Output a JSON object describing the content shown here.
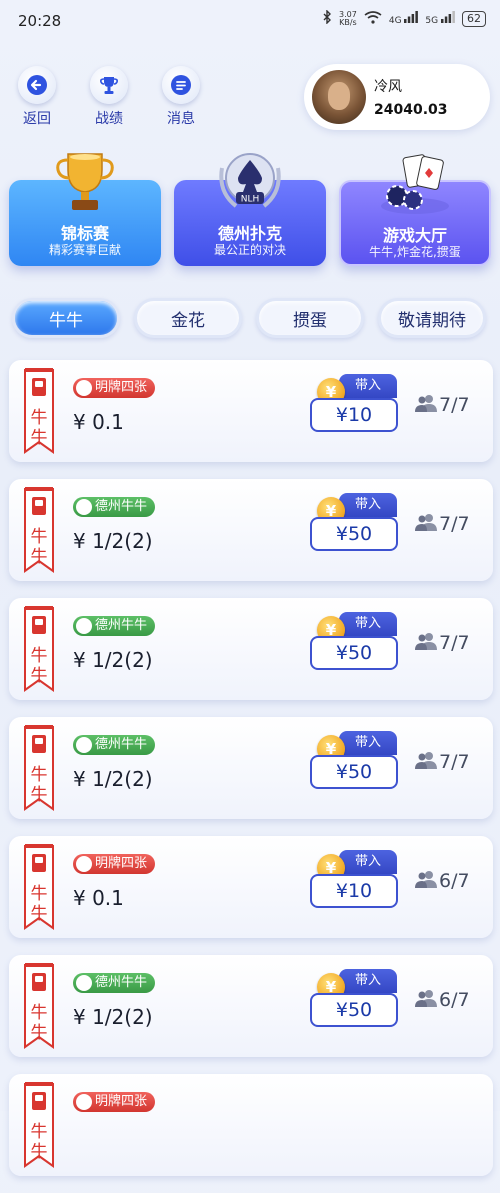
{
  "status_bar": {
    "time": "20:28",
    "net_speed": "3.07",
    "net_unit": "KB/s",
    "signal1": "4G",
    "signal2": "5G",
    "battery": "62"
  },
  "nav": {
    "back": "返回",
    "record": "战绩",
    "messages": "消息"
  },
  "user": {
    "name": "冷风",
    "balance": "24040.03"
  },
  "features": [
    {
      "title": "锦标赛",
      "subtitle": "精彩赛事巨献"
    },
    {
      "title": "德州扑克",
      "subtitle": "最公正的对决",
      "logo_text": "NLH"
    },
    {
      "title": "游戏大厅",
      "subtitle": "牛牛,炸金花,掼蛋"
    }
  ],
  "tabs": [
    "牛牛",
    "金花",
    "掼蛋",
    "敬请期待"
  ],
  "active_tab": 0,
  "rooms": [
    {
      "banner": [
        "牛",
        "牛"
      ],
      "badge": "明牌四张",
      "badge_color": "red",
      "stake": "¥ 0.1",
      "buyin_label": "带入",
      "buyin": "¥10",
      "players": "7/7"
    },
    {
      "banner": [
        "牛",
        "牛"
      ],
      "badge": "德州牛牛",
      "badge_color": "green",
      "stake": "¥ 1/2(2)",
      "buyin_label": "带入",
      "buyin": "¥50",
      "players": "7/7"
    },
    {
      "banner": [
        "牛",
        "牛"
      ],
      "badge": "德州牛牛",
      "badge_color": "green",
      "stake": "¥ 1/2(2)",
      "buyin_label": "带入",
      "buyin": "¥50",
      "players": "7/7"
    },
    {
      "banner": [
        "牛",
        "牛"
      ],
      "badge": "德州牛牛",
      "badge_color": "green",
      "stake": "¥ 1/2(2)",
      "buyin_label": "带入",
      "buyin": "¥50",
      "players": "7/7"
    },
    {
      "banner": [
        "牛",
        "牛"
      ],
      "badge": "明牌四张",
      "badge_color": "red",
      "stake": "¥ 0.1",
      "buyin_label": "带入",
      "buyin": "¥10",
      "players": "6/7"
    },
    {
      "banner": [
        "牛",
        "牛"
      ],
      "badge": "德州牛牛",
      "badge_color": "green",
      "stake": "¥ 1/2(2)",
      "buyin_label": "带入",
      "buyin": "¥50",
      "players": "6/7"
    },
    {
      "banner": [
        "牛",
        "牛"
      ],
      "badge": "明牌四张",
      "badge_color": "red",
      "stake": "",
      "buyin_label": "",
      "buyin": "",
      "players": ""
    }
  ],
  "colors": {
    "accent": "#3447c4",
    "red_badge": "#d23630",
    "green_badge": "#3a9a46",
    "coin": "#f1a722"
  }
}
